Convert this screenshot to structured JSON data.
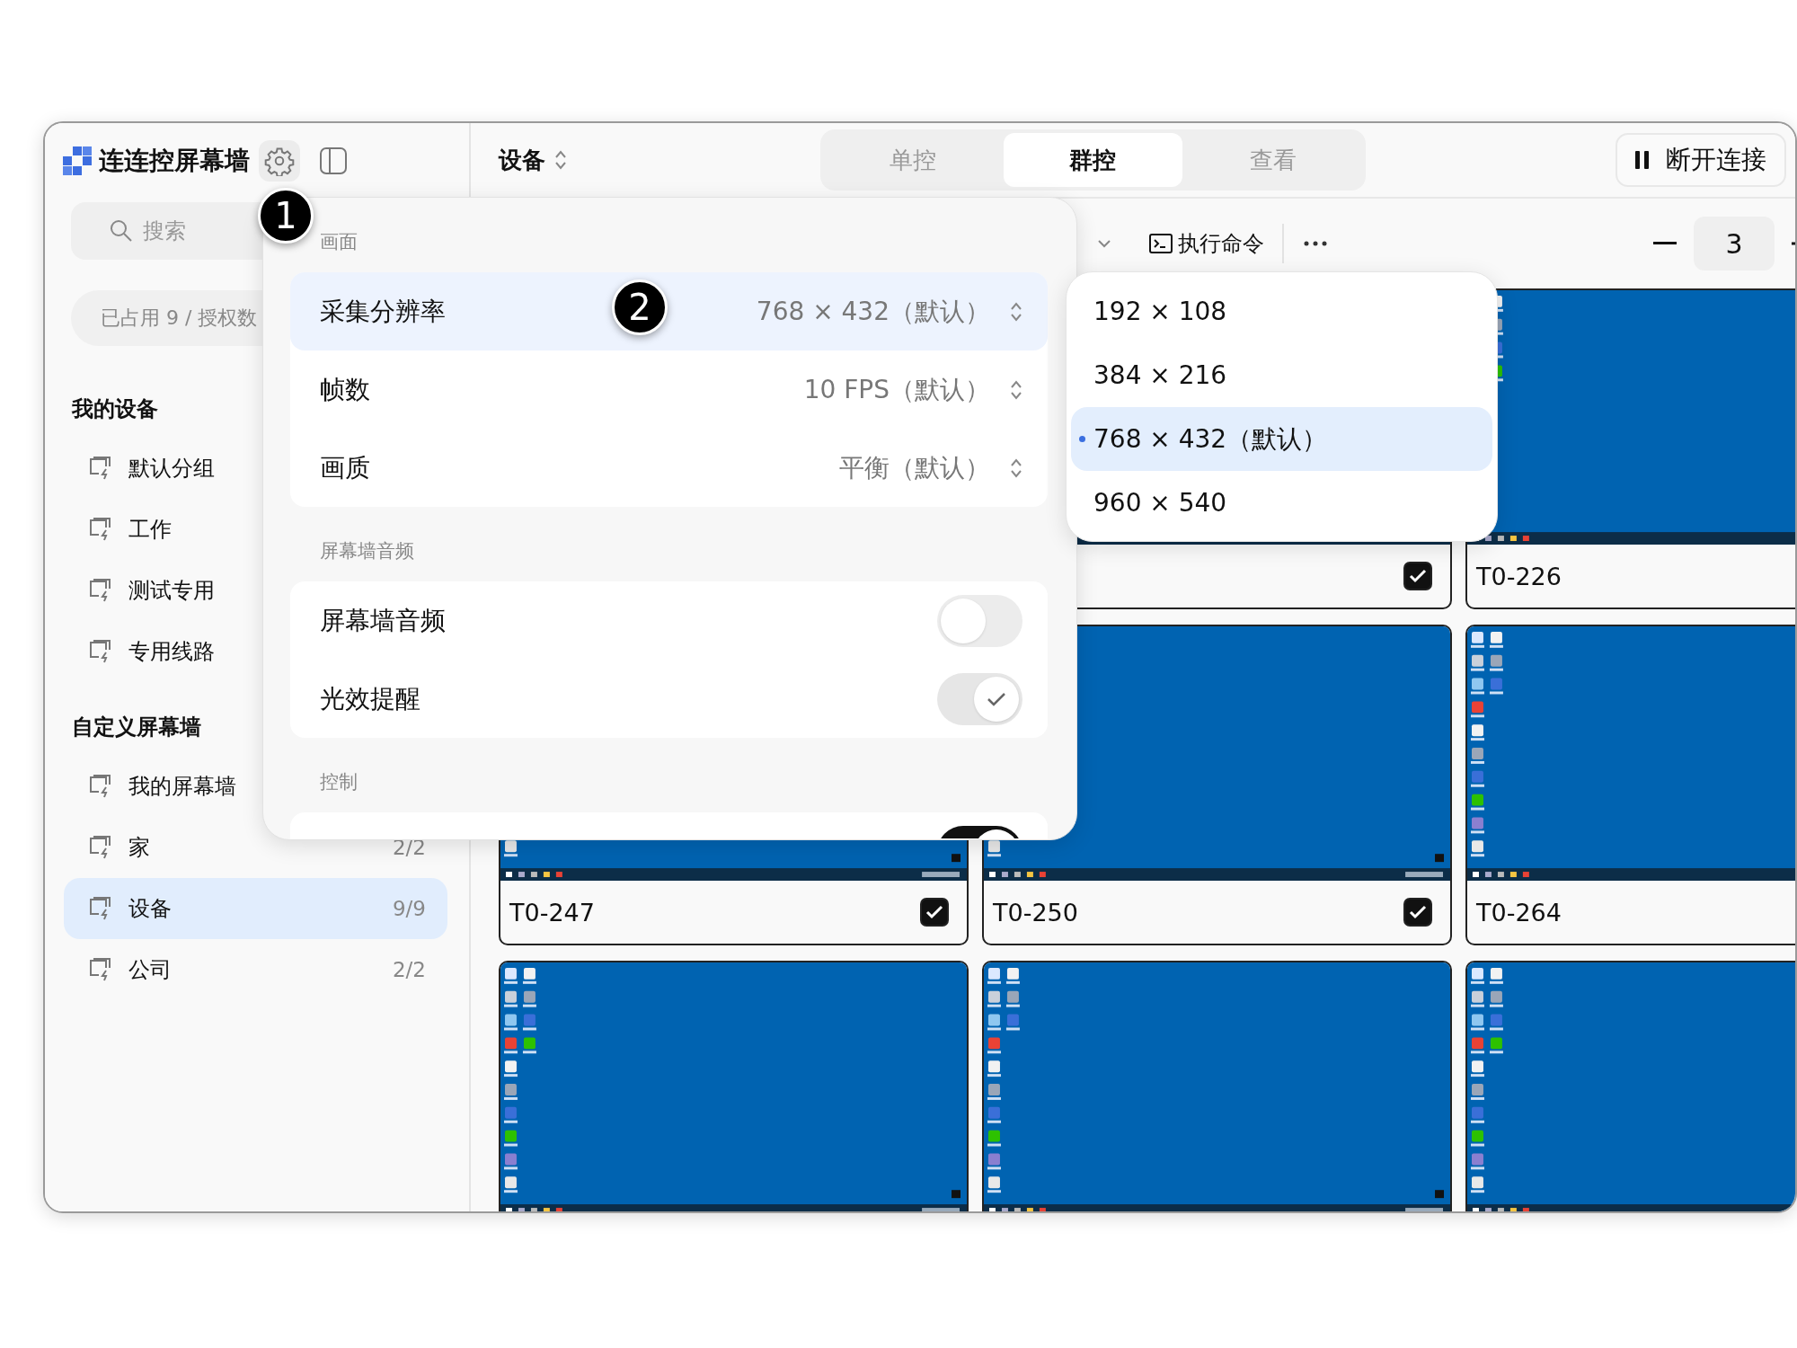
{
  "app": {
    "title": "连连控屏幕墙"
  },
  "sidebar": {
    "search": {
      "placeholder": "搜索"
    },
    "license": "已占用 9 / 授权数",
    "sections": [
      {
        "title": "我的设备",
        "items": [
          {
            "label": "默认分组",
            "selected": false
          },
          {
            "label": "工作",
            "selected": false
          },
          {
            "label": "测试专用",
            "selected": false
          },
          {
            "label": "专用线路",
            "selected": false
          }
        ]
      },
      {
        "title": "自定义屏幕墙",
        "items": [
          {
            "label": "我的屏幕墙",
            "selected": false
          },
          {
            "label": "家",
            "count": "2/2",
            "selected": false
          },
          {
            "label": "设备",
            "count": "9/9",
            "selected": true
          },
          {
            "label": "公司",
            "count": "2/2",
            "selected": false
          }
        ]
      }
    ]
  },
  "header": {
    "title": "设备",
    "tabs": [
      {
        "label": "单控",
        "selected": false
      },
      {
        "label": "群控",
        "selected": true
      },
      {
        "label": "查看",
        "selected": false
      }
    ],
    "disconnect_button": "断开连接"
  },
  "toolbar": {
    "run_command": "执行命令",
    "columns": "3"
  },
  "tiles": [
    {
      "kind": "screen",
      "checked": true
    },
    {
      "kind": "screen",
      "label": "T0-226"
    },
    {
      "kind": "screen",
      "label": "T0-247",
      "checked": true
    },
    {
      "kind": "screen",
      "label": "T0-250",
      "checked": true
    },
    {
      "kind": "screen",
      "label": "T0-264"
    },
    {
      "kind": "screen"
    },
    {
      "kind": "screen"
    },
    {
      "kind": "screen"
    }
  ],
  "settings_popover": {
    "sections": [
      {
        "title": "画面",
        "rows": [
          {
            "kind": "select",
            "label": "采集分辨率",
            "value": "768 × 432（默认）",
            "selected": true
          },
          {
            "kind": "select",
            "label": "帧数",
            "value": "10 FPS（默认）",
            "selected": false
          },
          {
            "kind": "select",
            "label": "画质",
            "value": "平衡（默认）",
            "selected": false
          }
        ]
      },
      {
        "title": "屏幕墙音频",
        "rows": [
          {
            "kind": "toggle",
            "label": "屏幕墙音频",
            "on": false,
            "disabled": false
          },
          {
            "kind": "toggle",
            "label": "光效提醒",
            "on": true,
            "disabled": true
          }
        ]
      },
      {
        "title": "控制",
        "rows": [
          {
            "kind": "toggle",
            "on": true,
            "disabled": false
          }
        ]
      }
    ]
  },
  "resolution_options": [
    {
      "label": "192 × 108",
      "selected": false
    },
    {
      "label": "384 × 216",
      "selected": false
    },
    {
      "label": "768 × 432（默认）",
      "selected": true
    },
    {
      "label": "960 × 540",
      "selected": false
    }
  ],
  "annotations": [
    {
      "label": "1"
    },
    {
      "label": "2"
    }
  ]
}
